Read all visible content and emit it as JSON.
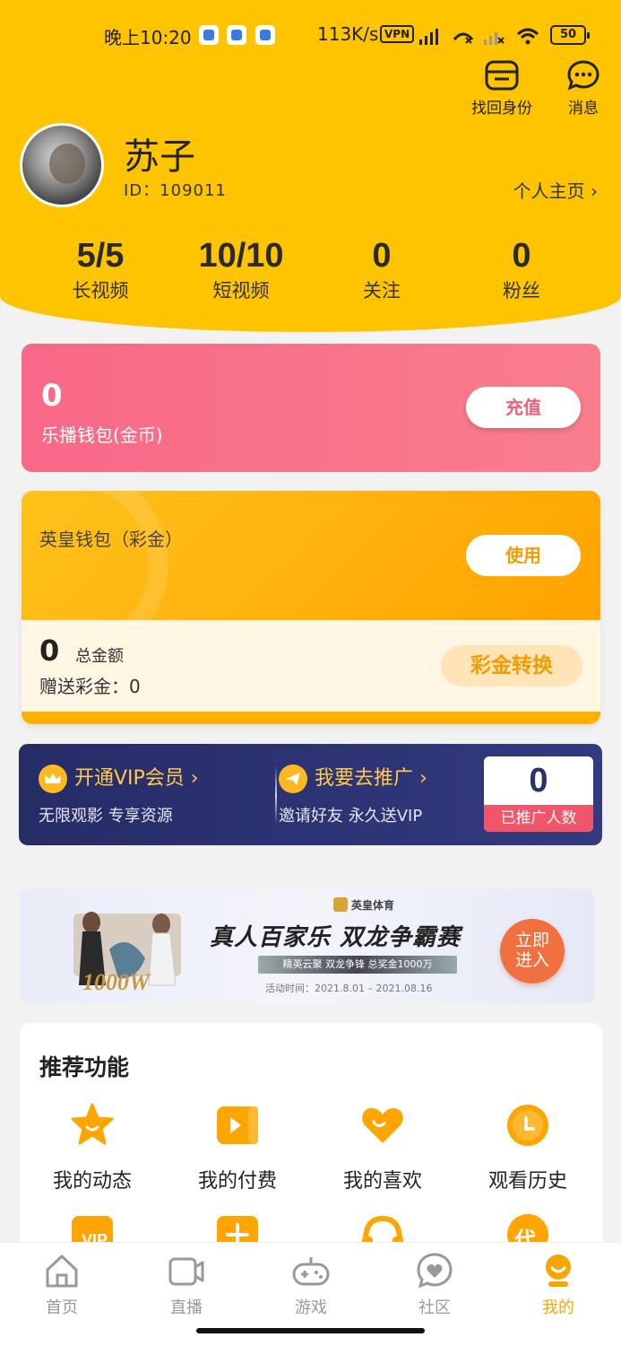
{
  "status_bar": {
    "time": "晚上10:20",
    "speed": "113K/s",
    "vpn": "VPN",
    "battery": "50"
  },
  "header": {
    "recover_label": "找回身份",
    "message_label": "消息",
    "username": "苏子",
    "user_id": "ID：109011",
    "homepage_link": "个人主页 ›",
    "stats": [
      {
        "value": "5/5",
        "label": "长视频"
      },
      {
        "value": "10/10",
        "label": "短视频"
      },
      {
        "value": "0",
        "label": "关注"
      },
      {
        "value": "0",
        "label": "粉丝"
      }
    ]
  },
  "wallet": {
    "amount": "0",
    "label": "乐播钱包(金币)",
    "button": "充值"
  },
  "yh_wallet": {
    "title": "英皇钱包（彩金）",
    "button": "使用",
    "amount": "0",
    "amount_label": "总金额",
    "gift": "赠送彩金：0",
    "convert_button": "彩金转换"
  },
  "vip_banner": {
    "vip_title": "开通VIP会员 ›",
    "vip_sub": "无限观影 专享资源",
    "promo_title": "我要去推广 ›",
    "promo_sub": "邀请好友 永久送VIP",
    "promo_count": "0",
    "promo_count_label": "已推广人数"
  },
  "ad": {
    "brand": "英皇体育",
    "title": "真人百家乐  双龙争霸赛",
    "subtitle": "精英云聚 双龙争锋 总奖金1000万",
    "date": "活动时间：2021.8.01 – 2021.08.16",
    "prize": "1000W",
    "button": "立即进入"
  },
  "features": {
    "title": "推荐功能",
    "items": [
      {
        "label": "我的动态",
        "icon": "star-icon"
      },
      {
        "label": "我的付费",
        "icon": "play-video-icon"
      },
      {
        "label": "我的喜欢",
        "icon": "heart-icon"
      },
      {
        "label": "观看历史",
        "icon": "clock-icon"
      }
    ],
    "row2_icons": [
      "vip-icon",
      "plus-icon",
      "headset-icon",
      "agent-icon"
    ],
    "row2_partial_text": "代"
  },
  "tabs": [
    {
      "label": "首页",
      "icon": "home-icon"
    },
    {
      "label": "直播",
      "icon": "camera-icon"
    },
    {
      "label": "游戏",
      "icon": "gamepad-icon"
    },
    {
      "label": "社区",
      "icon": "chat-heart-icon"
    },
    {
      "label": "我的",
      "icon": "profile-icon",
      "active": true
    }
  ],
  "colors": {
    "brand_yellow": "#FFC400",
    "accent_orange": "#F5A600",
    "wallet_pink": "#F86888",
    "vip_navy": "#262C66"
  }
}
